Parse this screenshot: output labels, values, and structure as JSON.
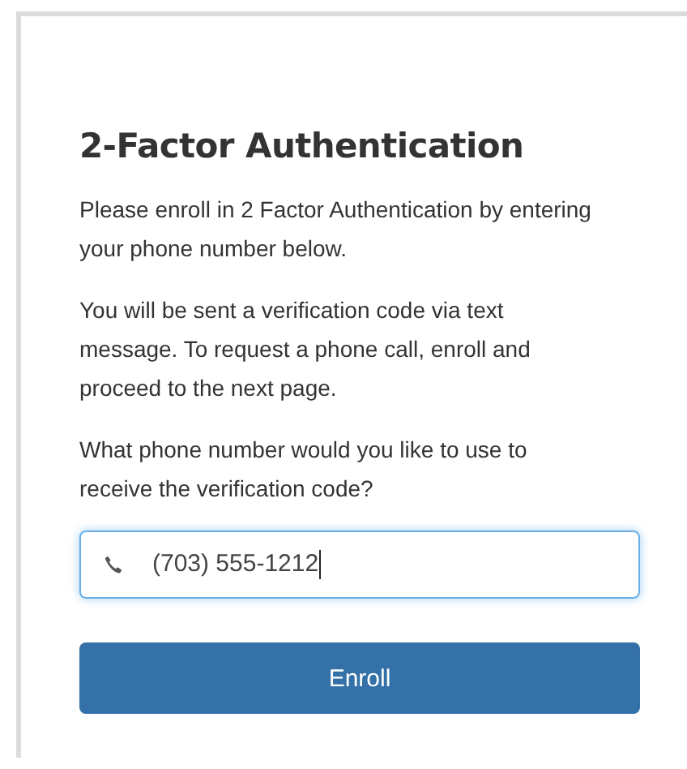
{
  "title": "2-Factor Authentication",
  "paragraphs": [
    "Please enroll in 2 Factor Authentication by entering your phone number below.",
    "You will be sent a verification code via text message. To request a phone call, enroll and proceed to the next page.",
    "What phone number would you like to use to receive the verification code?"
  ],
  "phone_field": {
    "value": "(703) 555-1212",
    "focused": true
  },
  "buttons": [
    "Enroll"
  ]
}
